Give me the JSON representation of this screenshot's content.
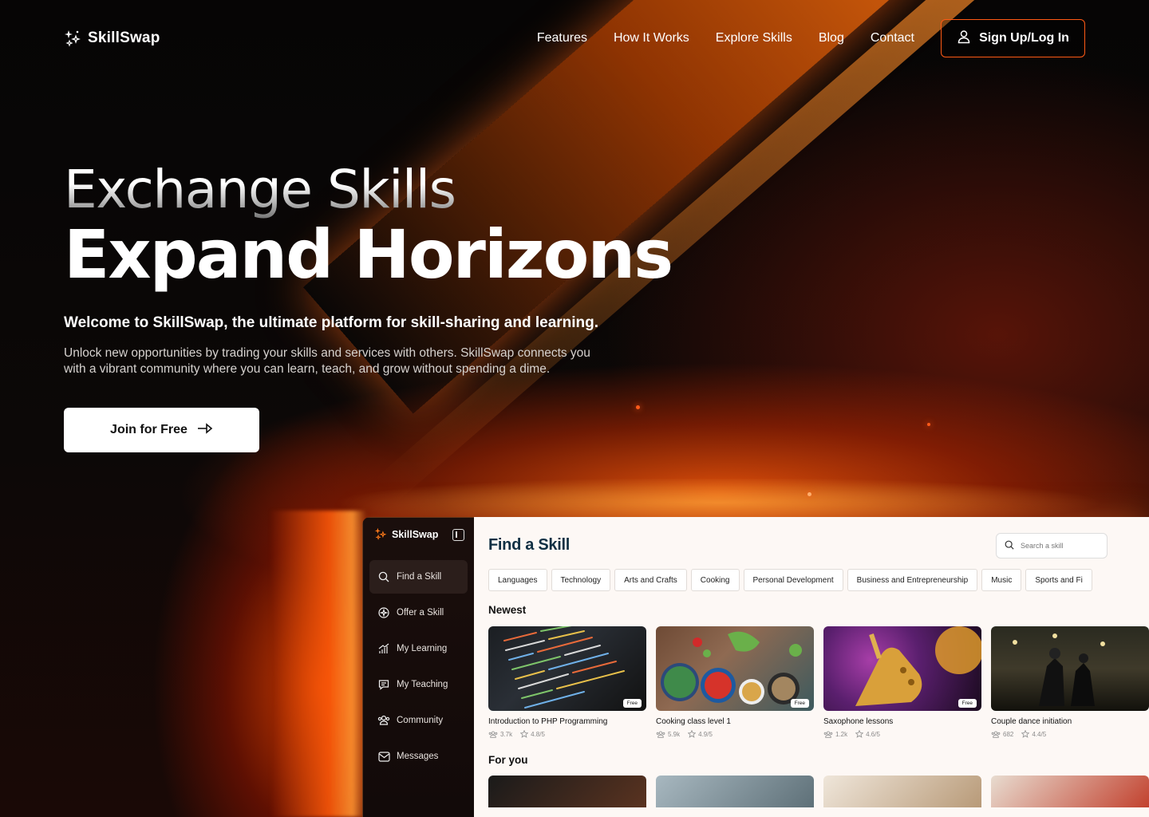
{
  "brand": {
    "name": "SkillSwap",
    "accent": "#ff5a14"
  },
  "nav": {
    "links": [
      "Features",
      "How It Works",
      "Explore Skills",
      "Blog",
      "Contact"
    ],
    "cta": "Sign Up/Log In"
  },
  "hero": {
    "line1": "Exchange Skills",
    "line2": "Expand Horizons",
    "lead": "Welcome to SkillSwap, the ultimate platform for skill-sharing and learning.",
    "sub": "Unlock new opportunities by trading your skills and services with others. SkillSwap connects you with a vibrant community where you can learn, teach, and grow without spending a dime.",
    "button": "Join for Free"
  },
  "app": {
    "logo": "SkillSwap",
    "sidebar": [
      {
        "label": "Find a Skill",
        "icon": "search-icon"
      },
      {
        "label": "Offer a Skill",
        "icon": "offer-icon"
      },
      {
        "label": "My Learning",
        "icon": "chart-icon"
      },
      {
        "label": "My Teaching",
        "icon": "chat-icon"
      },
      {
        "label": "Community",
        "icon": "users-icon"
      },
      {
        "label": "Messages",
        "icon": "mail-icon"
      }
    ],
    "title": "Find a Skill",
    "search_placeholder": "Search a skill",
    "categories": [
      "Languages",
      "Technology",
      "Arts and Crafts",
      "Cooking",
      "Personal Development",
      "Business and Entrepreneurship",
      "Music",
      "Sports and Fi"
    ],
    "newest_heading": "Newest",
    "newest": [
      {
        "title": "Introduction to PHP Programming",
        "learners": "3.7k",
        "rating": "4.8/5",
        "badge": "Free"
      },
      {
        "title": "Cooking class level 1",
        "learners": "5.9k",
        "rating": "4.9/5",
        "badge": "Free"
      },
      {
        "title": "Saxophone lessons",
        "learners": "1.2k",
        "rating": "4.6/5",
        "badge": "Free"
      },
      {
        "title": "Couple dance initiation",
        "learners": "682",
        "rating": "4.4/5",
        "badge": ""
      }
    ],
    "for_you_heading": "For you"
  }
}
